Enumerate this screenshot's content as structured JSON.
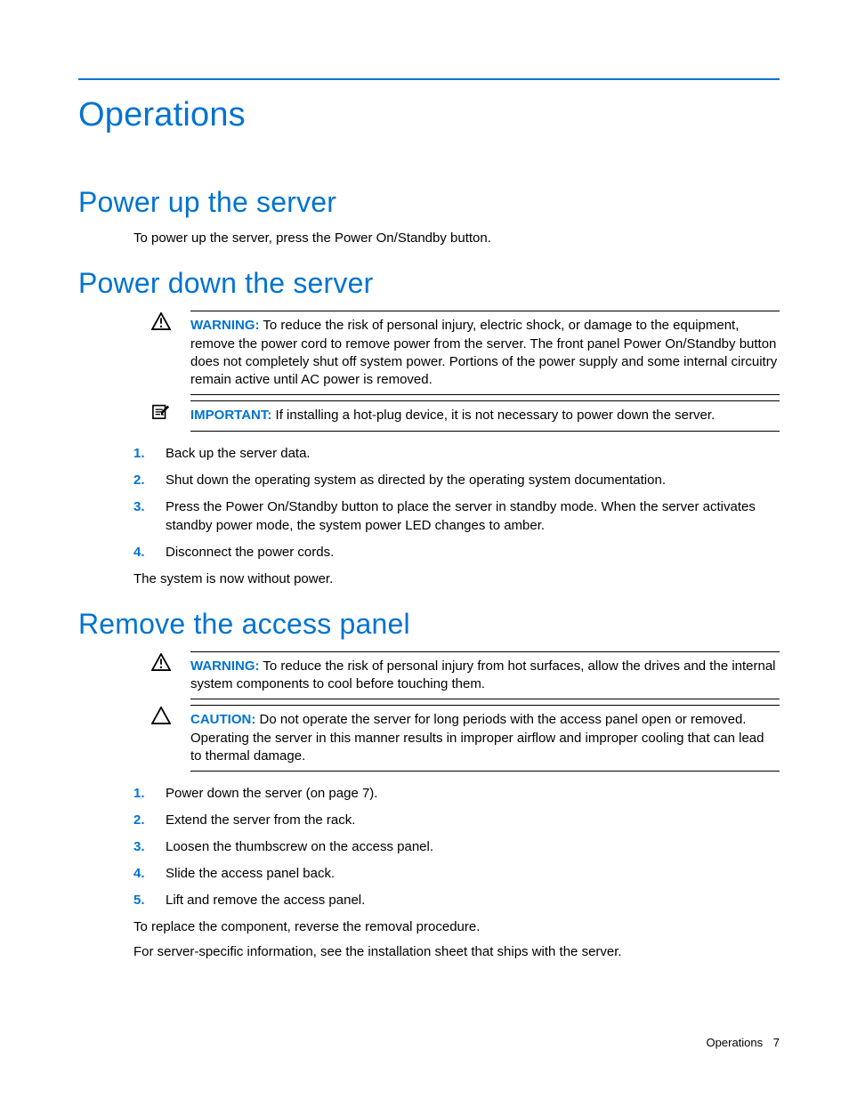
{
  "main_title": "Operations",
  "sections": {
    "power_up": {
      "title": "Power up the server",
      "para": "To power up the server, press the Power On/Standby button."
    },
    "power_down": {
      "title": "Power down the server",
      "warning_label": "WARNING:",
      "warning_text": "  To reduce the risk of personal injury, electric shock, or damage to the equipment, remove the power cord to remove power from the server. The front panel Power On/Standby button does not completely shut off system power. Portions of the power supply and some internal circuitry remain active until AC power is removed.",
      "important_label": "IMPORTANT:",
      "important_text": "  If installing a hot-plug device, it is not necessary to power down the server.",
      "steps": [
        "Back up the server data.",
        "Shut down the operating system as directed by the operating system documentation.",
        "Press the Power On/Standby button to place the server in standby mode. When the server activates standby power mode, the system power LED changes to amber.",
        "Disconnect the power cords."
      ],
      "trailing": "The system is now without power."
    },
    "remove_panel": {
      "title": "Remove the access panel",
      "warning_label": "WARNING:",
      "warning_text": "  To reduce the risk of personal injury from hot surfaces, allow the drives and the internal system components to cool before touching them.",
      "caution_label": "CAUTION:",
      "caution_text": "  Do not operate the server for long periods with the access panel open or removed. Operating the server in this manner results in improper airflow and improper cooling that can lead to thermal damage.",
      "steps": [
        "Power down the server (on page 7).",
        "Extend the server from the rack.",
        "Loosen the thumbscrew on the access panel.",
        "Slide the access panel back.",
        "Lift and remove the access panel."
      ],
      "trailing1": "To replace the component, reverse the removal procedure.",
      "trailing2": "For server-specific information, see the installation sheet that ships with the server."
    }
  },
  "footer": {
    "section": "Operations",
    "page": "7"
  }
}
